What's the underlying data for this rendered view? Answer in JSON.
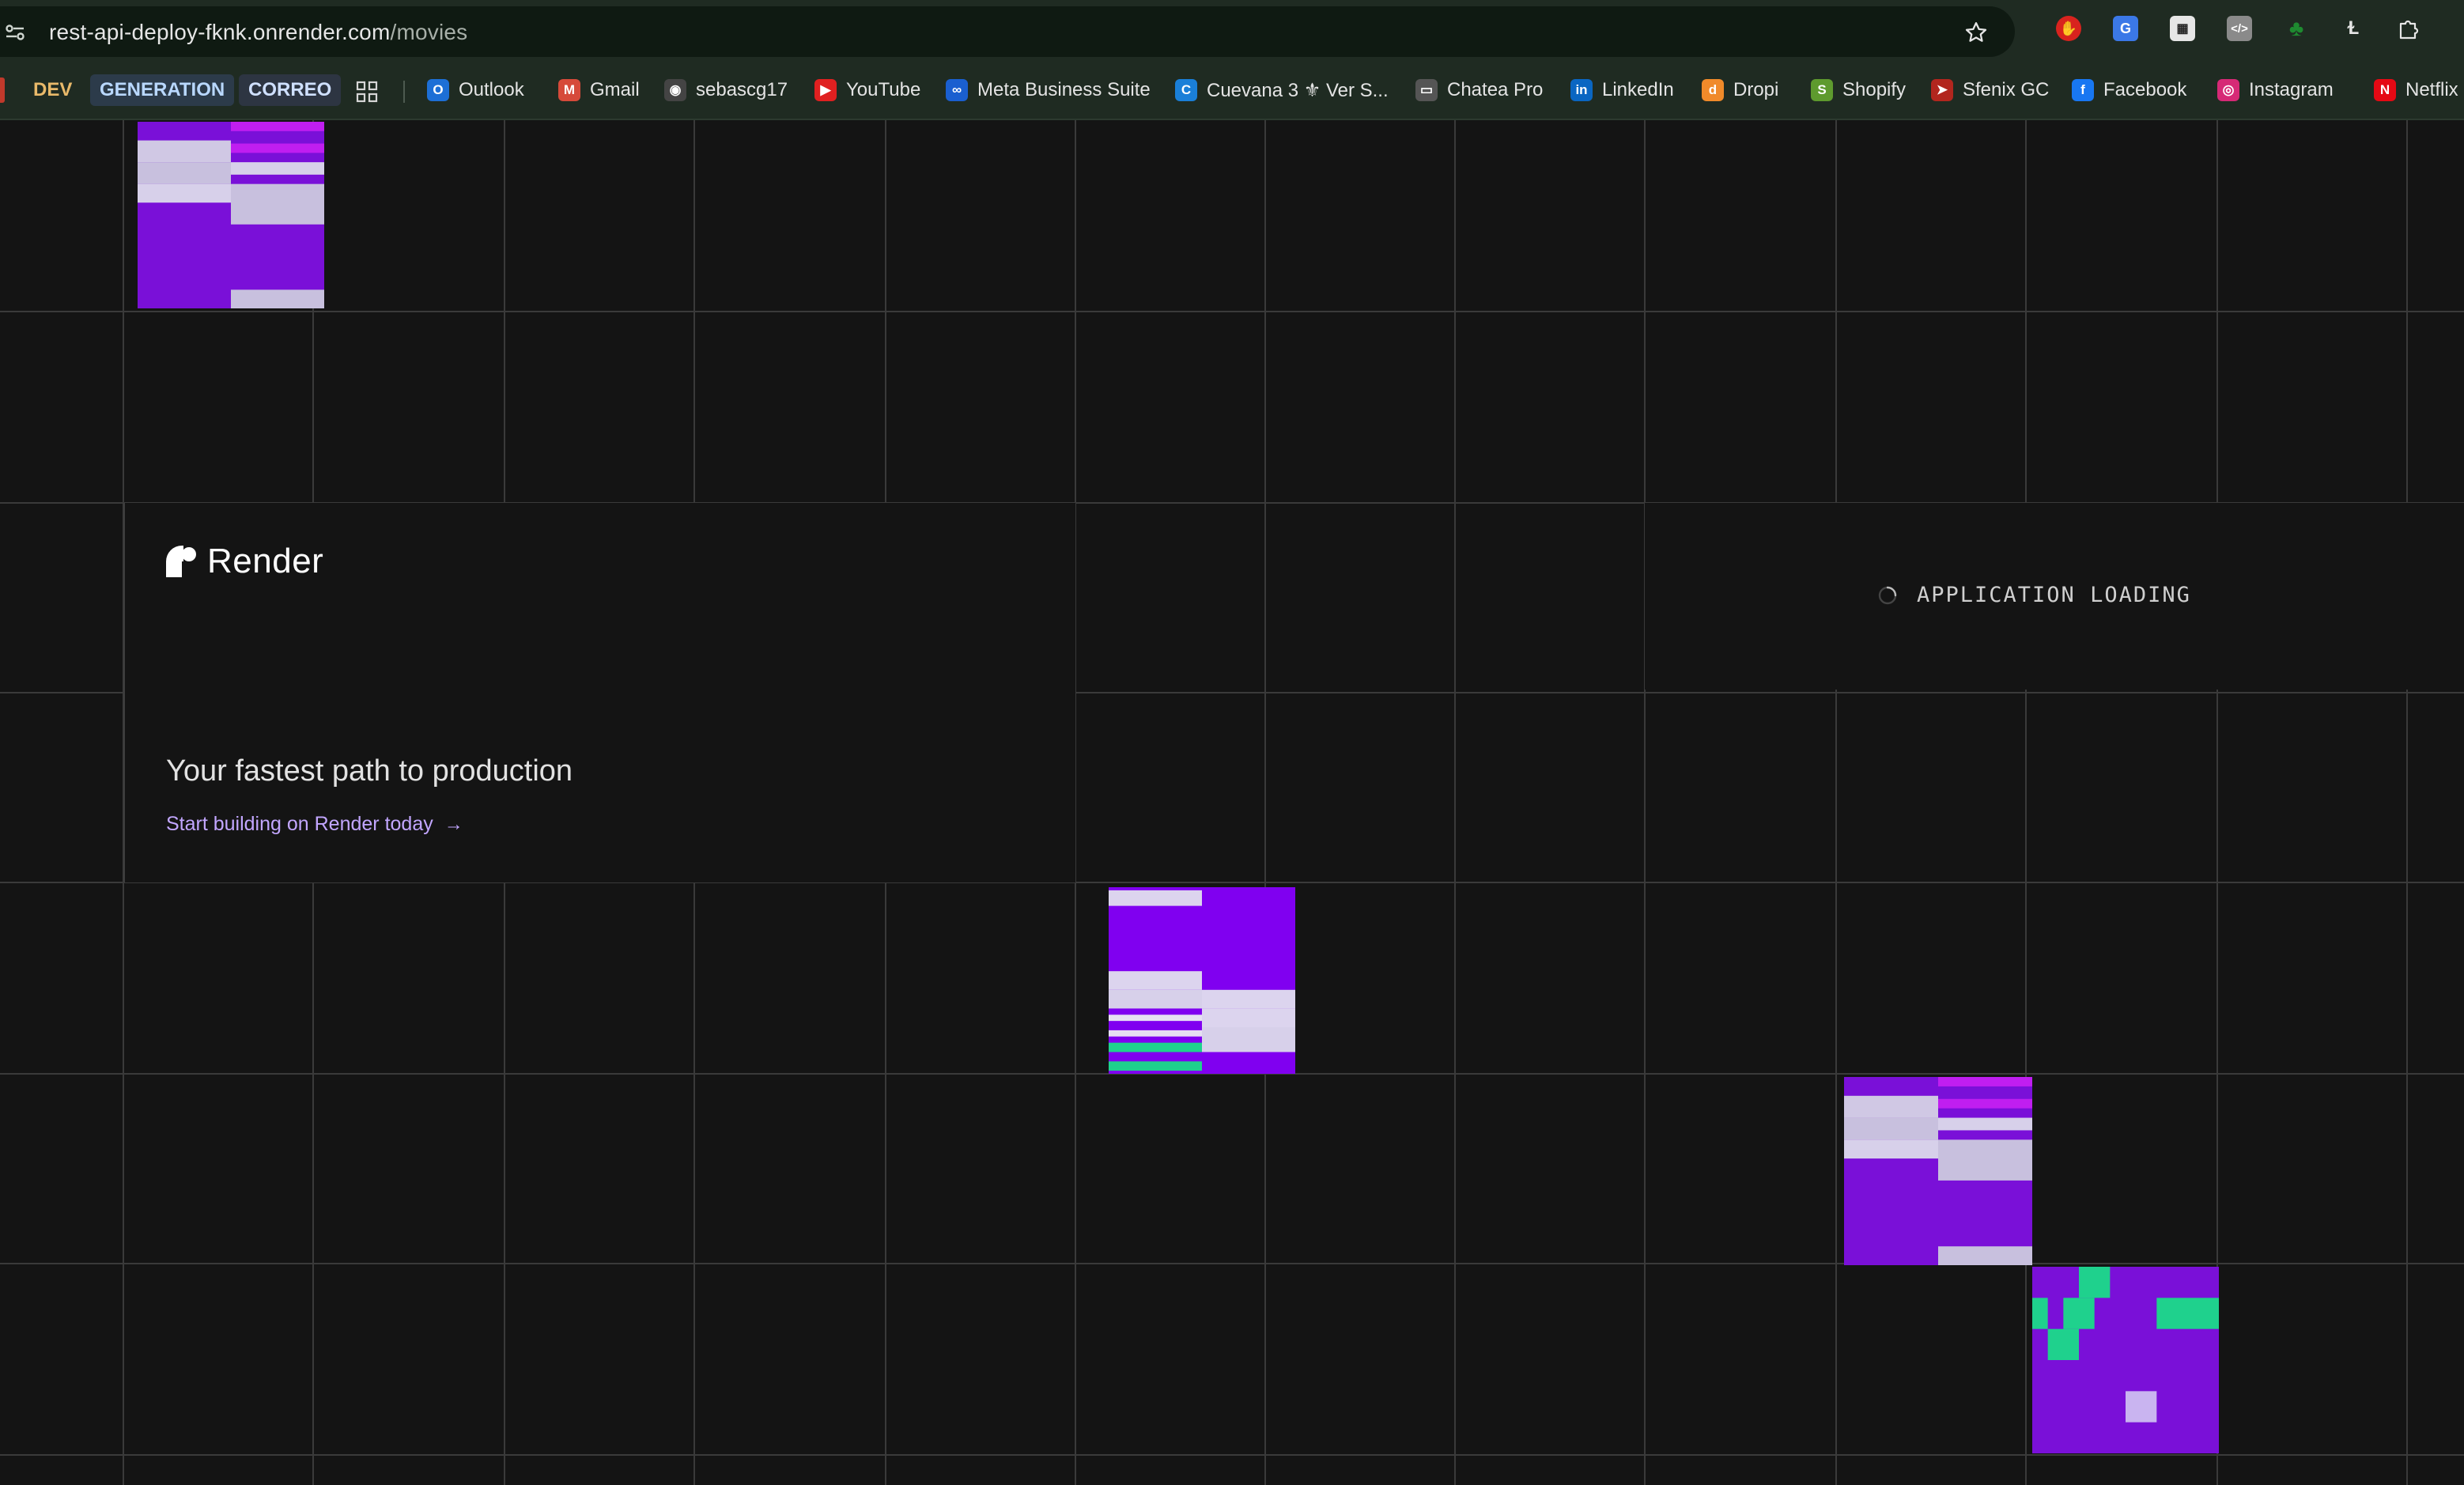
{
  "browser": {
    "url_host": "rest-api-deploy-fknk.onrender.com",
    "url_path": "/movies",
    "bookmark_chips": [
      {
        "label": "DEV",
        "color": "#e8b96a",
        "bg": "#3a3a2a"
      },
      {
        "label": "GENERATION",
        "color": "#b9d8ff",
        "bg": "#2c3b4a"
      },
      {
        "label": "CORREO",
        "color": "#cfe0ff",
        "bg": "#2d3542"
      }
    ],
    "bookmarks": [
      {
        "label": "Outlook",
        "icon": "outlook-icon",
        "glyph": "O",
        "color": "#1d6fd6"
      },
      {
        "label": "Gmail",
        "icon": "gmail-icon",
        "glyph": "M",
        "color": "#d64a3a"
      },
      {
        "label": "sebascg17",
        "icon": "github-icon",
        "glyph": "◉",
        "color": "#444"
      },
      {
        "label": "YouTube",
        "icon": "youtube-icon",
        "glyph": "▶",
        "color": "#e02020"
      },
      {
        "label": "Meta Business Suite",
        "icon": "meta-icon",
        "glyph": "∞",
        "color": "#1a5fd0"
      },
      {
        "label": "Cuevana 3 ⚜ Ver S...",
        "icon": "cuevana-icon",
        "glyph": "C",
        "color": "#1a7fd8"
      },
      {
        "label": "Chatea Pro",
        "icon": "chat-icon",
        "glyph": "▭",
        "color": "#555"
      },
      {
        "label": "LinkedIn",
        "icon": "linkedin-icon",
        "glyph": "in",
        "color": "#0a66c2"
      },
      {
        "label": "Dropi",
        "icon": "dropi-icon",
        "glyph": "d",
        "color": "#f08a2a"
      },
      {
        "label": "Shopify",
        "icon": "shopify-icon",
        "glyph": "S",
        "color": "#5e9a2e"
      },
      {
        "label": "Sfenix GC",
        "icon": "sfenix-icon",
        "glyph": "➤",
        "color": "#b2261e"
      },
      {
        "label": "Facebook",
        "icon": "facebook-icon",
        "glyph": "f",
        "color": "#1877f2"
      },
      {
        "label": "Instagram",
        "icon": "instagram-icon",
        "glyph": "◎",
        "color": "#d62976"
      },
      {
        "label": "Netflix",
        "icon": "netflix-icon",
        "glyph": "N",
        "color": "#e50914"
      }
    ]
  },
  "page": {
    "brand": "Render",
    "tagline": "Your fastest path to production",
    "cta": "Start building on Render today",
    "cta_arrow": "→",
    "loading": "APPLICATION LOADING"
  },
  "colors": {
    "purple": "#7a10d8",
    "magenta": "#c01ef0",
    "lavender": "#d7d0ea",
    "teal": "#1fd18d",
    "grid": "#3a3a3a"
  }
}
